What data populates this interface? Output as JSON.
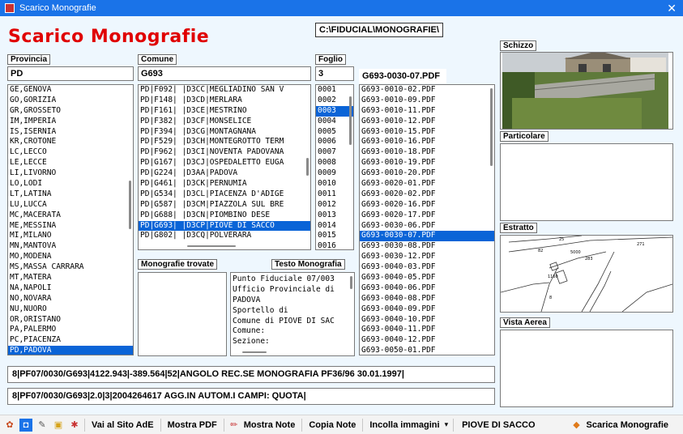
{
  "window": {
    "title": "Scarico Monografie"
  },
  "header": {
    "big_title": "Scarico Monografie",
    "path": "C:\\FIDUCIAL\\MONOGRAFIE\\"
  },
  "provincia": {
    "label": "Provincia",
    "value": "PD",
    "items": [
      "GE,GENOVA",
      "GO,GORIZIA",
      "GR,GROSSETO",
      "IM,IMPERIA",
      "IS,ISERNIA",
      "KR,CROTONE",
      "LC,LECCO",
      "LE,LECCE",
      "LI,LIVORNO",
      "LO,LODI",
      "LT,LATINA",
      "LU,LUCCA",
      "MC,MACERATA",
      "ME,MESSINA",
      "MI,MILANO",
      "MN,MANTOVA",
      "MO,MODENA",
      "MS,MASSA CARRARA",
      "MT,MATERA",
      "NA,NAPOLI",
      "NO,NOVARA",
      "NU,NUORO",
      "OR,ORISTANO",
      "PA,PALERMO",
      "PC,PIACENZA",
      "PD,PADOVA"
    ],
    "selected_index": 25
  },
  "comune": {
    "label": "Comune",
    "value": "G693",
    "items": [
      "PD|F092| |D3CC|MEGLIADINO SAN V",
      "PD|F148| |D3CD|MERLARA",
      "PD|F161| |D3CE|MESTRINO",
      "PD|F382| |D3CF|MONSELICE",
      "PD|F394| |D3CG|MONTAGNANA",
      "PD|F529| |D3CH|MONTEGROTTO TERM",
      "PD|F962| |D3CI|NOVENTA PADOVANA",
      "PD|G167| |D3CJ|OSPEDALETTO EUGA",
      "PD|G224| |D3AA|PADOVA",
      "PD|G461| |D3CK|PERNUMIA",
      "PD|G534| |D3CL|PIACENZA D'ADIGE",
      "PD|G587| |D3CM|PIAZZOLA SUL BRE",
      "PD|G688| |D3CN|PIOMBINO DESE",
      "PD|G693| |D3CP|PIOVE DI SACCO",
      "PD|G802| |D3CQ|POLVERARA"
    ],
    "selected_index": 13
  },
  "foglio": {
    "label": "Foglio",
    "value": "3",
    "items": [
      "0001",
      "0002",
      "0003",
      "0004",
      "0005",
      "0006",
      "0007",
      "0008",
      "0009",
      "0010",
      "0011",
      "0012",
      "0013",
      "0014",
      "0015",
      "0016"
    ],
    "selected_index": 2
  },
  "pdf": {
    "current": "G693-0030-07.PDF",
    "items": [
      "G693-0010-02.PDF",
      "G693-0010-09.PDF",
      "G693-0010-11.PDF",
      "G693-0010-12.PDF",
      "G693-0010-15.PDF",
      "G693-0010-16.PDF",
      "G693-0010-18.PDF",
      "G693-0010-19.PDF",
      "G693-0010-20.PDF",
      "G693-0020-01.PDF",
      "G693-0020-02.PDF",
      "G693-0020-16.PDF",
      "G693-0020-17.PDF",
      "G693-0030-06.PDF",
      "G693-0030-07.PDF",
      "G693-0030-08.PDF",
      "G693-0030-12.PDF",
      "G693-0040-03.PDF",
      "G693-0040-05.PDF",
      "G693-0040-06.PDF",
      "G693-0040-08.PDF",
      "G693-0040-09.PDF",
      "G693-0040-10.PDF",
      "G693-0040-11.PDF",
      "G693-0040-12.PDF",
      "G693-0050-01.PDF"
    ],
    "selected_index": 14
  },
  "monografie_trovate": {
    "label": "Monografie trovate"
  },
  "testo_monografia": {
    "label": "Testo Monografia",
    "lines": [
      "Punto Fiduciale 07/003",
      "Ufficio Provinciale di",
      "PADOVA",
      "Sportello di",
      "Comune di PIOVE DI SAC",
      "Comune:",
      "Sezione:"
    ]
  },
  "right_panels": {
    "schizzo": "Schizzo",
    "particolare": "Particolare",
    "estratto": "Estratto",
    "vista_aerea": "Vista Aerea",
    "map_labels": [
      "25",
      "271",
      "82",
      "5000",
      "283",
      "1160",
      "8"
    ]
  },
  "status": {
    "line1": "8|PF07/0030/G693|4122.943|-389.564|52|ANGOLO REC.SE MONOGRAFIA PF36/96 30.01.1997|",
    "line2": "8|PF07/0030/G693|2.0|3|2004264617 AGG.IN AUTOM.I CAMPI: QUOTA|"
  },
  "toolbar": {
    "vai_sito": "Vai al Sito AdE",
    "mostra_pdf": "Mostra PDF",
    "mostra_note": "Mostra Note",
    "copia_note": "Copia Note",
    "incolla_immagini": "Incolla immagini",
    "dropdown_arrow": "▾",
    "current_comune": "PIOVE DI SACCO",
    "scarica": "Scarica Monografie"
  },
  "colors": {
    "title_red": "#e00000",
    "selection": "#0a64d7",
    "titlebar": "#1a73e8",
    "background": "#eef7fe"
  }
}
